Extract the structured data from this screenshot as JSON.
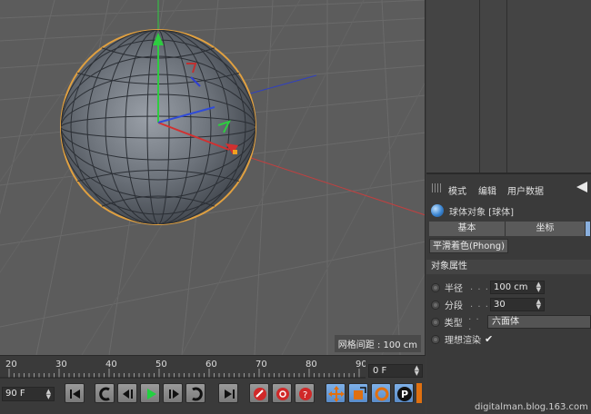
{
  "viewport": {
    "grid_spacing_label": "网格间距 : 100 cm"
  },
  "attribute_manager": {
    "menu": [
      "模式",
      "编辑",
      "用户数据"
    ],
    "object_title": "球体对象 [球体]",
    "tabs": [
      "基本",
      "坐标"
    ],
    "phong_tab": "平滑着色(Phong)",
    "section_title": "对象属性",
    "properties": {
      "radius": {
        "label": "半径",
        "dots": ". . .",
        "value": "100 cm"
      },
      "segments": {
        "label": "分段",
        "dots": ". . .",
        "value": "30"
      },
      "type": {
        "label": "类型",
        "dots": ". . .",
        "value": "六面体"
      },
      "render_perfect": {
        "label": "理想渲染",
        "checked": "✔"
      }
    }
  },
  "timeline": {
    "ticks": [
      "20",
      "30",
      "40",
      "50",
      "60",
      "70",
      "80",
      "90"
    ],
    "current_frame": "0 F",
    "end_frame": "90 F"
  },
  "icons": {
    "go_start": "go-to-start-icon",
    "prev_key": "previous-keyframe-icon",
    "prev_frame": "previous-frame-icon",
    "play": "play-icon",
    "next_frame": "next-frame-icon",
    "next_key": "next-keyframe-icon",
    "go_end": "go-to-end-icon",
    "record": "record-icon",
    "auto_key": "auto-keyframe-icon",
    "key_help": "keyframe-selection-icon",
    "move": "move-key-icon",
    "scale": "scale-key-icon",
    "rotate": "rotate-key-icon",
    "param": "parameter-key-icon"
  },
  "watermark": "digitalman.blog.163.com",
  "colors": {
    "axis_x": "#d23030",
    "axis_y": "#2ecc40",
    "axis_z": "#2f4bd8",
    "selection_outline": "#e0a040"
  }
}
